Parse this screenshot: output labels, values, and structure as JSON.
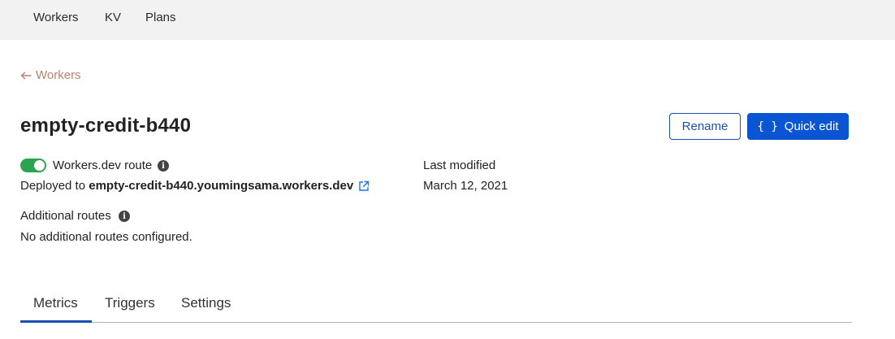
{
  "topnav": {
    "items": [
      {
        "label": "Workers"
      },
      {
        "label": "KV"
      },
      {
        "label": "Plans"
      }
    ]
  },
  "breadcrumb": {
    "back_label": "Workers"
  },
  "worker": {
    "name": "empty-credit-b440",
    "workers_dev_route_label": "Workers.dev route",
    "workers_dev_route_enabled": true,
    "deployed_prefix": "Deployed to",
    "deployed_url": "empty-credit-b440.youmingsama.workers.dev",
    "additional_routes_label": "Additional routes",
    "additional_routes_value": "No additional routes configured.",
    "last_modified_label": "Last modified",
    "last_modified_value": "March 12, 2021"
  },
  "actions": {
    "rename_label": "Rename",
    "quick_edit_icon": "{ }",
    "quick_edit_label": "Quick edit"
  },
  "tabs": [
    {
      "label": "Metrics",
      "active": true
    },
    {
      "label": "Triggers",
      "active": false
    },
    {
      "label": "Settings",
      "active": false
    }
  ],
  "colors": {
    "accent": "#0b55d4",
    "toggle_on": "#2aa44f",
    "breadcrumb": "#b9826e"
  },
  "icons": {
    "back": "arrow-left-icon",
    "info": "info-icon",
    "external": "external-link-icon"
  }
}
